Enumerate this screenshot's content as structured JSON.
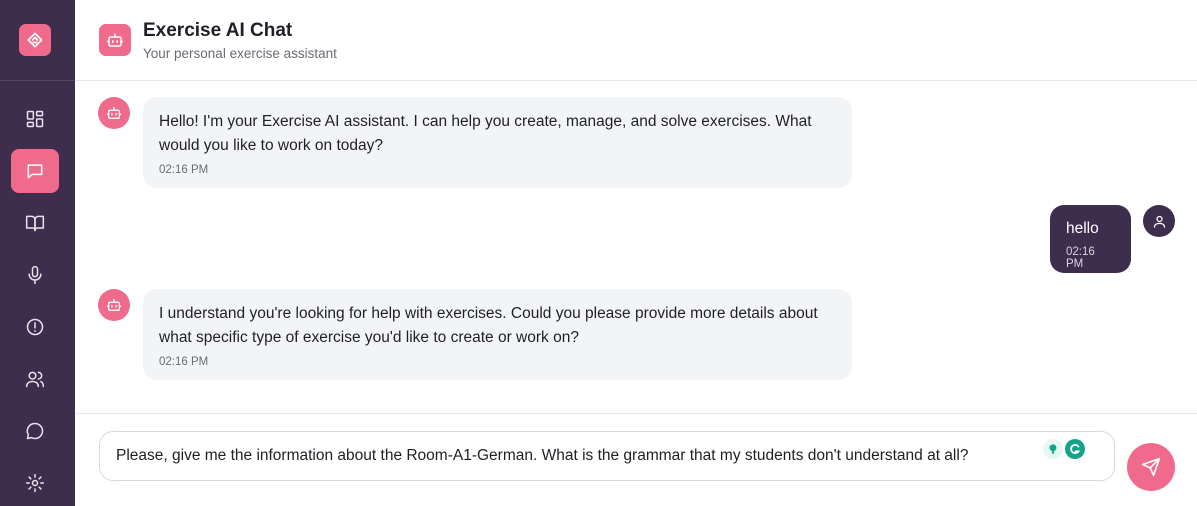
{
  "app": {
    "title": "Exercise AI Chat",
    "subtitle": "Your personal exercise assistant"
  },
  "sidebar": {
    "items": [
      {
        "icon": "dashboard-icon",
        "active": false
      },
      {
        "icon": "chat-icon",
        "active": true
      },
      {
        "icon": "book-icon",
        "active": false
      },
      {
        "icon": "microphone-icon",
        "active": false
      },
      {
        "icon": "alert-circle-icon",
        "active": false
      },
      {
        "icon": "users-icon",
        "active": false
      },
      {
        "icon": "message-circle-icon",
        "active": false
      },
      {
        "icon": "settings-icon",
        "active": false
      }
    ]
  },
  "messages": [
    {
      "role": "assistant",
      "text": "Hello! I'm your Exercise AI assistant. I can help you create, manage, and solve exercises. What would you like to work on today?",
      "time": "02:16 PM"
    },
    {
      "role": "user",
      "text": "hello",
      "time": "02:16 PM"
    },
    {
      "role": "assistant",
      "text": "I understand you're looking for help with exercises. Could you please provide more details about what specific type of exercise you'd like to create or work on?",
      "time": "02:16 PM"
    }
  ],
  "composer": {
    "value": "Please, give me the information about the Room-A1-German. What is the grammar that my students don't understand at all?"
  },
  "colors": {
    "sidebar": "#3f2d4e",
    "accent": "#f06a8c",
    "bot_bubble": "#f3f4f6",
    "user_bubble": "#3f2d4e"
  }
}
